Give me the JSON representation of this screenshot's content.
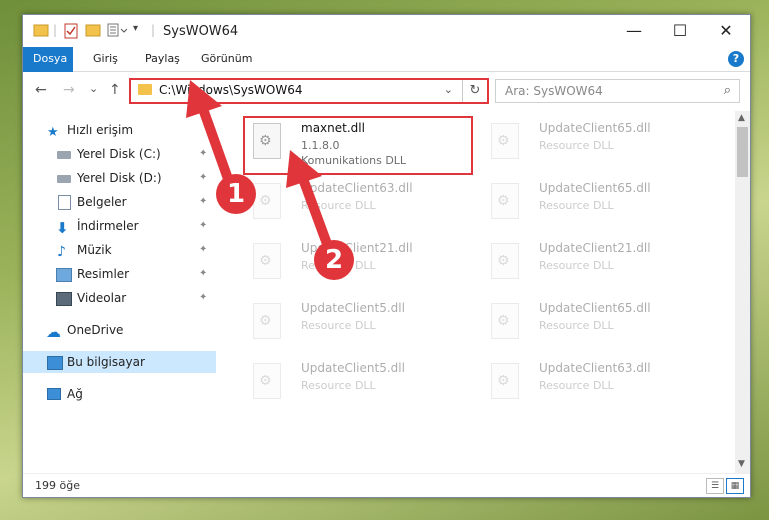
{
  "window": {
    "title": "SysWOW64"
  },
  "window_controls": {
    "minimize": "—",
    "maximize": "☐",
    "close": "✕"
  },
  "ribbon": {
    "tabs": [
      "Dosya",
      "Giriş",
      "Paylaş",
      "Görünüm"
    ],
    "help": "?"
  },
  "nav": {
    "back": "←",
    "forward": "→",
    "recent": "⌄",
    "up": "↑"
  },
  "address": {
    "path": "C:\\Windows\\SysWOW64",
    "dropdown": "⌄",
    "refresh": "↻"
  },
  "search": {
    "placeholder": "Ara: SysWOW64",
    "icon": "⌕"
  },
  "sidebar": {
    "items": [
      {
        "label": "Hızlı erişim",
        "icon": "star-icon",
        "pinned": false
      },
      {
        "label": "Yerel Disk (C:)",
        "icon": "drive-icon",
        "pinned": true
      },
      {
        "label": "Yerel Disk (D:)",
        "icon": "drive-icon",
        "pinned": true
      },
      {
        "label": "Belgeler",
        "icon": "document-icon",
        "pinned": true
      },
      {
        "label": "İndirmeler",
        "icon": "download-icon",
        "pinned": true
      },
      {
        "label": "Müzik",
        "icon": "music-icon",
        "pinned": true
      },
      {
        "label": "Resimler",
        "icon": "pictures-icon",
        "pinned": true
      },
      {
        "label": "Videolar",
        "icon": "video-icon",
        "pinned": true
      },
      {
        "label": "OneDrive",
        "icon": "cloud-icon",
        "pinned": false
      },
      {
        "label": "Bu bilgisayar",
        "icon": "computer-icon",
        "pinned": false,
        "selected": true
      },
      {
        "label": "Ağ",
        "icon": "network-icon",
        "pinned": false
      }
    ],
    "pin_glyph": "📌"
  },
  "files": [
    {
      "name": "maxnet.dll",
      "version": "1.1.8.0",
      "desc": "Komunikations DLL"
    },
    {
      "name": "UpdateClient65.dll",
      "version": "",
      "desc": "Resource DLL"
    },
    {
      "name": "UpdateClient63.dll",
      "version": "",
      "desc": "Resource DLL"
    },
    {
      "name": "UpdateClient65.dll",
      "version": "",
      "desc": "Resource DLL"
    },
    {
      "name": "UpdateClient21.dll",
      "version": "",
      "desc": "Resource DLL"
    },
    {
      "name": "UpdateClient21.dll",
      "version": "",
      "desc": "Resource DLL"
    },
    {
      "name": "UpdateClient5.dll",
      "version": "",
      "desc": "Resource DLL"
    },
    {
      "name": "UpdateClient65.dll",
      "version": "",
      "desc": "Resource DLL"
    },
    {
      "name": "UpdateClient5.dll",
      "version": "",
      "desc": "Resource DLL"
    },
    {
      "name": "UpdateClient63.dll",
      "version": "",
      "desc": "Resource DLL"
    }
  ],
  "status": {
    "count": "199 öğe",
    "details_view": "☰",
    "icons_view": "▦"
  },
  "annotations": {
    "badge1": "1",
    "badge2": "2",
    "color": "#e0353a"
  },
  "colors": {
    "accent": "#1979ca",
    "highlight": "#e0353a",
    "folder": "#f3c24a"
  }
}
